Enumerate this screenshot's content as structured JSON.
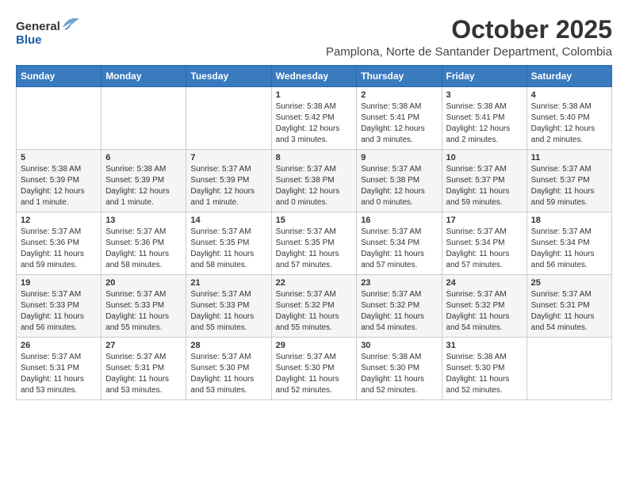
{
  "logo": {
    "general": "General",
    "blue": "Blue"
  },
  "title": "October 2025",
  "location": "Pamplona, Norte de Santander Department, Colombia",
  "days_of_week": [
    "Sunday",
    "Monday",
    "Tuesday",
    "Wednesday",
    "Thursday",
    "Friday",
    "Saturday"
  ],
  "weeks": [
    [
      {
        "day": "",
        "info": ""
      },
      {
        "day": "",
        "info": ""
      },
      {
        "day": "",
        "info": ""
      },
      {
        "day": "1",
        "info": "Sunrise: 5:38 AM\nSunset: 5:42 PM\nDaylight: 12 hours and 3 minutes."
      },
      {
        "day": "2",
        "info": "Sunrise: 5:38 AM\nSunset: 5:41 PM\nDaylight: 12 hours and 3 minutes."
      },
      {
        "day": "3",
        "info": "Sunrise: 5:38 AM\nSunset: 5:41 PM\nDaylight: 12 hours and 2 minutes."
      },
      {
        "day": "4",
        "info": "Sunrise: 5:38 AM\nSunset: 5:40 PM\nDaylight: 12 hours and 2 minutes."
      }
    ],
    [
      {
        "day": "5",
        "info": "Sunrise: 5:38 AM\nSunset: 5:39 PM\nDaylight: 12 hours and 1 minute."
      },
      {
        "day": "6",
        "info": "Sunrise: 5:38 AM\nSunset: 5:39 PM\nDaylight: 12 hours and 1 minute."
      },
      {
        "day": "7",
        "info": "Sunrise: 5:37 AM\nSunset: 5:39 PM\nDaylight: 12 hours and 1 minute."
      },
      {
        "day": "8",
        "info": "Sunrise: 5:37 AM\nSunset: 5:38 PM\nDaylight: 12 hours and 0 minutes."
      },
      {
        "day": "9",
        "info": "Sunrise: 5:37 AM\nSunset: 5:38 PM\nDaylight: 12 hours and 0 minutes."
      },
      {
        "day": "10",
        "info": "Sunrise: 5:37 AM\nSunset: 5:37 PM\nDaylight: 11 hours and 59 minutes."
      },
      {
        "day": "11",
        "info": "Sunrise: 5:37 AM\nSunset: 5:37 PM\nDaylight: 11 hours and 59 minutes."
      }
    ],
    [
      {
        "day": "12",
        "info": "Sunrise: 5:37 AM\nSunset: 5:36 PM\nDaylight: 11 hours and 59 minutes."
      },
      {
        "day": "13",
        "info": "Sunrise: 5:37 AM\nSunset: 5:36 PM\nDaylight: 11 hours and 58 minutes."
      },
      {
        "day": "14",
        "info": "Sunrise: 5:37 AM\nSunset: 5:35 PM\nDaylight: 11 hours and 58 minutes."
      },
      {
        "day": "15",
        "info": "Sunrise: 5:37 AM\nSunset: 5:35 PM\nDaylight: 11 hours and 57 minutes."
      },
      {
        "day": "16",
        "info": "Sunrise: 5:37 AM\nSunset: 5:34 PM\nDaylight: 11 hours and 57 minutes."
      },
      {
        "day": "17",
        "info": "Sunrise: 5:37 AM\nSunset: 5:34 PM\nDaylight: 11 hours and 57 minutes."
      },
      {
        "day": "18",
        "info": "Sunrise: 5:37 AM\nSunset: 5:34 PM\nDaylight: 11 hours and 56 minutes."
      }
    ],
    [
      {
        "day": "19",
        "info": "Sunrise: 5:37 AM\nSunset: 5:33 PM\nDaylight: 11 hours and 56 minutes."
      },
      {
        "day": "20",
        "info": "Sunrise: 5:37 AM\nSunset: 5:33 PM\nDaylight: 11 hours and 55 minutes."
      },
      {
        "day": "21",
        "info": "Sunrise: 5:37 AM\nSunset: 5:33 PM\nDaylight: 11 hours and 55 minutes."
      },
      {
        "day": "22",
        "info": "Sunrise: 5:37 AM\nSunset: 5:32 PM\nDaylight: 11 hours and 55 minutes."
      },
      {
        "day": "23",
        "info": "Sunrise: 5:37 AM\nSunset: 5:32 PM\nDaylight: 11 hours and 54 minutes."
      },
      {
        "day": "24",
        "info": "Sunrise: 5:37 AM\nSunset: 5:32 PM\nDaylight: 11 hours and 54 minutes."
      },
      {
        "day": "25",
        "info": "Sunrise: 5:37 AM\nSunset: 5:31 PM\nDaylight: 11 hours and 54 minutes."
      }
    ],
    [
      {
        "day": "26",
        "info": "Sunrise: 5:37 AM\nSunset: 5:31 PM\nDaylight: 11 hours and 53 minutes."
      },
      {
        "day": "27",
        "info": "Sunrise: 5:37 AM\nSunset: 5:31 PM\nDaylight: 11 hours and 53 minutes."
      },
      {
        "day": "28",
        "info": "Sunrise: 5:37 AM\nSunset: 5:30 PM\nDaylight: 11 hours and 53 minutes."
      },
      {
        "day": "29",
        "info": "Sunrise: 5:37 AM\nSunset: 5:30 PM\nDaylight: 11 hours and 52 minutes."
      },
      {
        "day": "30",
        "info": "Sunrise: 5:38 AM\nSunset: 5:30 PM\nDaylight: 11 hours and 52 minutes."
      },
      {
        "day": "31",
        "info": "Sunrise: 5:38 AM\nSunset: 5:30 PM\nDaylight: 11 hours and 52 minutes."
      },
      {
        "day": "",
        "info": ""
      }
    ]
  ]
}
